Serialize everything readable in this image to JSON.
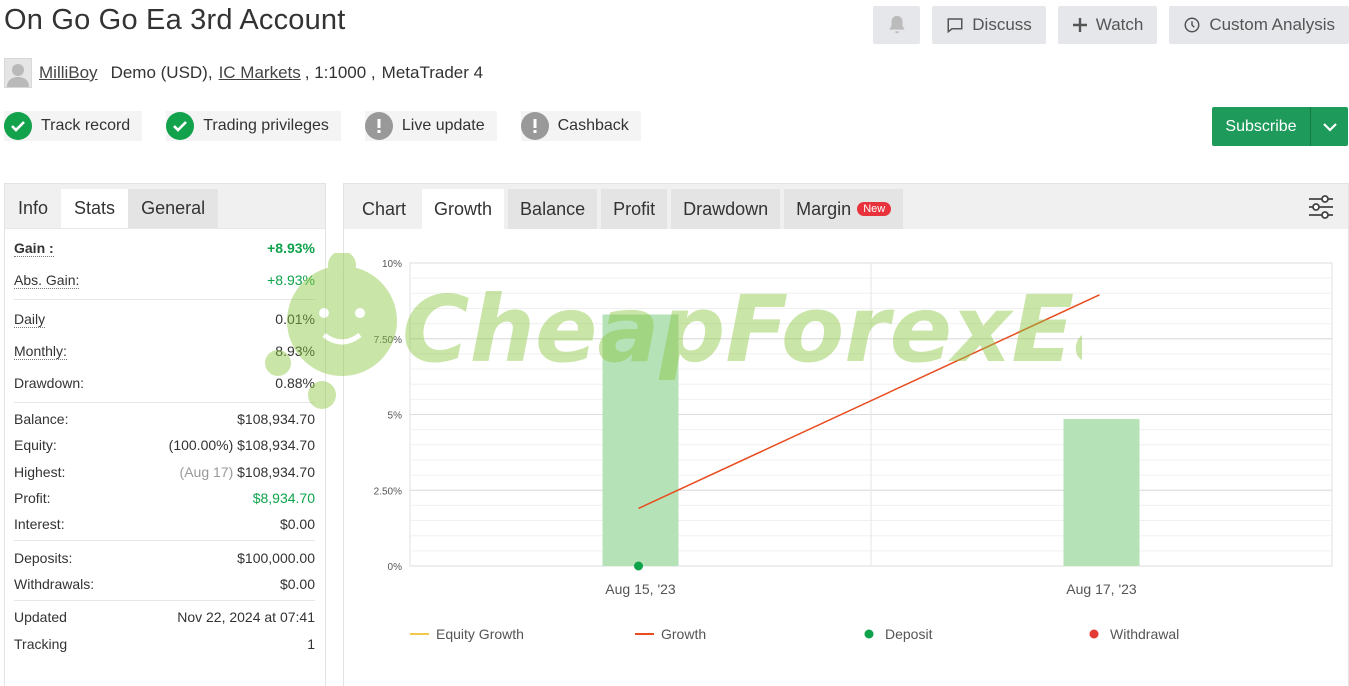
{
  "title": "On Go Go Ea 3rd Account",
  "actions": {
    "bell_icon": "bell-icon",
    "discuss": "Discuss",
    "watch": "Watch",
    "custom_analysis": "Custom Analysis"
  },
  "meta": {
    "user": "MilliBoy",
    "account_type": "Demo (USD),",
    "broker": "IC Markets",
    "leverage": ", 1:1000 ,",
    "platform": "MetaTrader 4"
  },
  "badges": {
    "track_record": "Track record",
    "trading_privileges": "Trading privileges",
    "live_update": "Live update",
    "cashback": "Cashback"
  },
  "subscribe": "Subscribe",
  "left_tabs": {
    "info": "Info",
    "stats": "Stats",
    "general": "General"
  },
  "stats": {
    "gain_label": "Gain :",
    "gain_value": "+8.93%",
    "abs_gain_label": "Abs. Gain:",
    "abs_gain_value": "+8.93%",
    "daily_label": "Daily",
    "daily_value": "0.01%",
    "monthly_label": "Monthly:",
    "monthly_value": "8.93%",
    "drawdown_label": "Drawdown:",
    "drawdown_value": "0.88%",
    "balance_label": "Balance:",
    "balance_value": "$108,934.70",
    "equity_label": "Equity:",
    "equity_pct": "(100.00%)",
    "equity_value": "$108,934.70",
    "highest_label": "Highest:",
    "highest_date": "(Aug 17)",
    "highest_value": "$108,934.70",
    "profit_label": "Profit:",
    "profit_value": "$8,934.70",
    "interest_label": "Interest:",
    "interest_value": "$0.00",
    "deposits_label": "Deposits:",
    "deposits_value": "$100,000.00",
    "withdrawals_label": "Withdrawals:",
    "withdrawals_value": "$0.00",
    "updated_label": "Updated",
    "updated_value": "Nov 22, 2024 at 07:41",
    "tracking_label": "Tracking",
    "tracking_value": "1"
  },
  "chart_tabs": {
    "chart": "Chart",
    "growth": "Growth",
    "balance": "Balance",
    "profit": "Profit",
    "drawdown": "Drawdown",
    "margin": "Margin",
    "new_badge": "New"
  },
  "watermark": "CheapForexEa",
  "colors": {
    "accent_green": "#1e9a5b",
    "gain_green": "#0ea34b",
    "bar_fill": "#b6e2b8",
    "growth_line": "#e84c1f",
    "equity_line": "#f2c94c",
    "deposit": "#0ea34b",
    "withdrawal": "#e53935"
  },
  "chart_data": {
    "type": "bar",
    "categories": [
      "Aug 15, '23",
      "Aug 17, '23"
    ],
    "ylim": [
      0,
      10
    ],
    "yticks": [
      0,
      2.5,
      5,
      7.5,
      10
    ],
    "ytick_labels": [
      "0%",
      "2.50%",
      "5%",
      "7.50%",
      "10%"
    ],
    "series": [
      {
        "name": "Equity Growth",
        "values": []
      },
      {
        "name": "Growth",
        "values": [
          1.9,
          8.95
        ]
      },
      {
        "name": "Deposit",
        "values": [
          0,
          null
        ]
      },
      {
        "name": "Withdrawal",
        "values": []
      }
    ],
    "bars": [
      8.3,
      4.85
    ],
    "legend": [
      "Equity Growth",
      "Growth",
      "Deposit",
      "Withdrawal"
    ],
    "legend_position": "bottom"
  }
}
